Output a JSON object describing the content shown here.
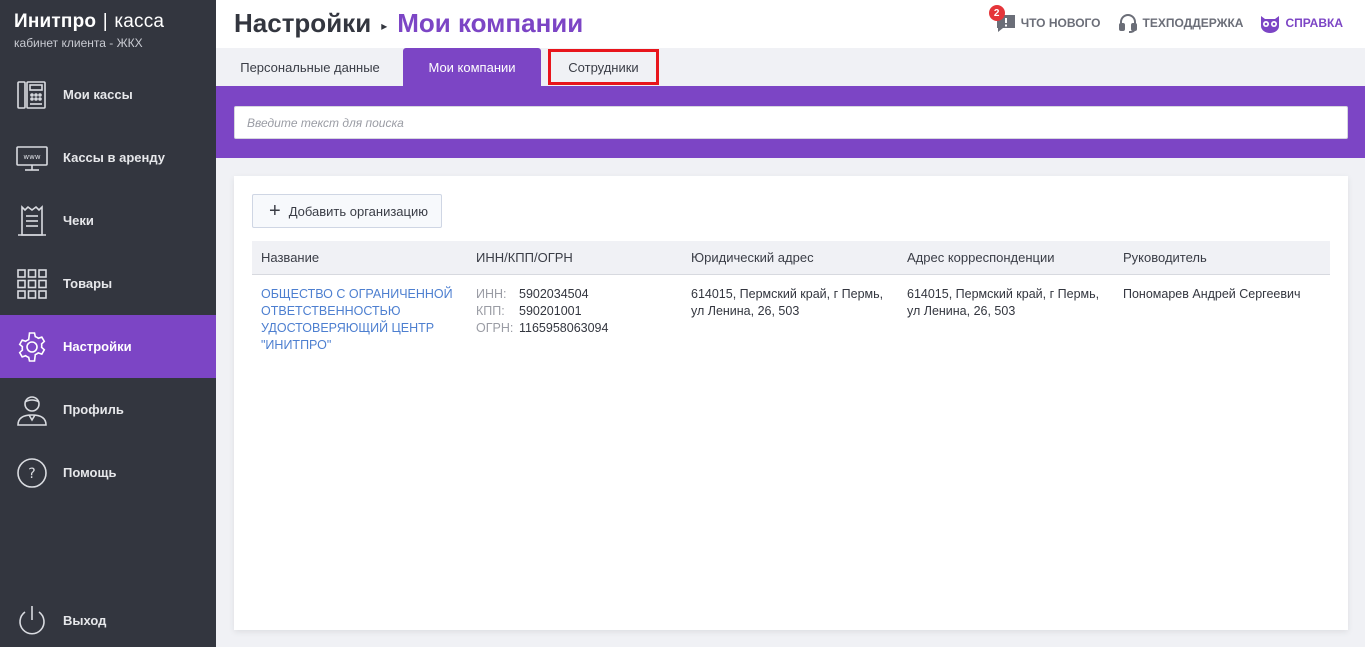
{
  "brand": {
    "name": "Инитпро",
    "separator": "|",
    "product": "касса",
    "subtitle": "кабинет клиента - ЖКХ"
  },
  "sidebar": {
    "items": [
      {
        "label": "Мои кассы",
        "icon": "cash-register-icon",
        "active": false
      },
      {
        "label": "Кассы в аренду",
        "icon": "monitor-www-icon",
        "active": false
      },
      {
        "label": "Чеки",
        "icon": "receipt-icon",
        "active": false
      },
      {
        "label": "Товары",
        "icon": "grid-icon",
        "active": false
      },
      {
        "label": "Настройки",
        "icon": "gear-icon",
        "active": true
      },
      {
        "label": "Профиль",
        "icon": "user-icon",
        "active": false
      },
      {
        "label": "Помощь",
        "icon": "question-icon",
        "active": false
      }
    ],
    "logout": {
      "label": "Выход",
      "icon": "power-icon"
    }
  },
  "header": {
    "breadcrumb_root": "Настройки",
    "breadcrumb_arrow": "▸",
    "breadcrumb_current": "Мои компании",
    "links": {
      "news": {
        "label": "ЧТО НОВОГО",
        "badge": "2",
        "icon": "chat-alert-icon"
      },
      "support": {
        "label": "ТЕХПОДДЕРЖКА",
        "icon": "headset-icon"
      },
      "help": {
        "label": "СПРАВКА",
        "icon": "owl-icon"
      }
    }
  },
  "tabs": [
    {
      "label": "Персональные данные",
      "active": false
    },
    {
      "label": "Мои компании",
      "active": true
    },
    {
      "label": "Сотрудники",
      "active": false,
      "highlighted": true
    }
  ],
  "search": {
    "placeholder": "Введите текст для поиска",
    "value": ""
  },
  "content": {
    "add_button": "Добавить организацию",
    "columns": [
      "Название",
      "ИНН/КПП/ОГРН",
      "Юридический адрес",
      "Адрес корреспонденции",
      "Руководитель"
    ],
    "rows": [
      {
        "name": "ОБЩЕСТВО С ОГРАНИЧЕННОЙ ОТВЕТСТВЕННОСТЬЮ УДОСТОВЕРЯЮЩИЙ ЦЕНТР \"ИНИТПРО\"",
        "inn_label": "ИНН:",
        "inn": "5902034504",
        "kpp_label": "КПП:",
        "kpp": "590201001",
        "ogrn_label": "ОГРН:",
        "ogrn": "1165958063094",
        "legal_address": "614015, Пермский край, г Пермь, ул Ленина, 26, 503",
        "postal_address": "614015, Пермский край, г Пермь, ул Ленина, 26, 503",
        "director": "Пономарев Андрей Сергеевич"
      }
    ]
  },
  "colors": {
    "accent": "#7c45c5",
    "sidebar_bg": "#33363f",
    "link": "#4d7fd0",
    "badge": "#e5353a",
    "highlight_border": "#e8151c"
  }
}
